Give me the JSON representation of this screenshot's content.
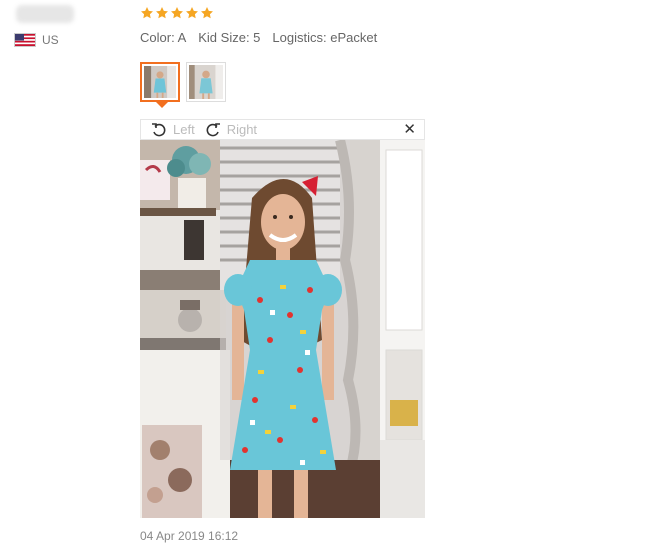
{
  "reviewer": {
    "country_code": "US",
    "flag_icon": "us-flag-icon"
  },
  "review": {
    "rating": 5,
    "rating_max": 5,
    "star_color": "#f5a623",
    "attributes": {
      "color": "Color: A",
      "kid_size": "Kid Size: 5",
      "logistics": "Logistics: ePacket"
    },
    "thumbnails": [
      {
        "name": "thumbnail-1",
        "active": true
      },
      {
        "name": "thumbnail-2",
        "active": false
      }
    ],
    "viewer": {
      "rotate_left_label": "Left",
      "rotate_right_label": "Right",
      "close_icon": "close-icon"
    },
    "date": "04 Apr 2019 16:12"
  }
}
